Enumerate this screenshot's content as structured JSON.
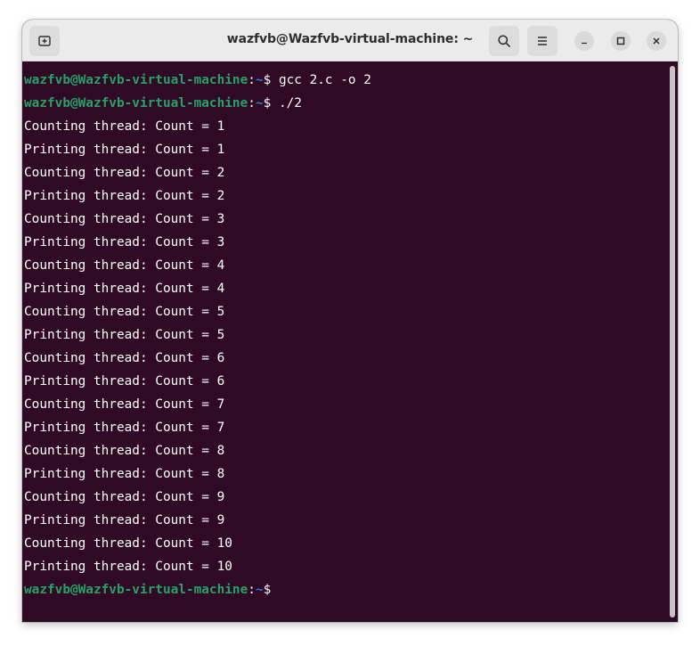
{
  "window": {
    "title": "wazfvb@Wazfvb-virtual-machine: ~"
  },
  "icons": {
    "new_tab": "new-tab-icon",
    "search": "search-icon",
    "menu": "hamburger-menu-icon",
    "minimize": "minimize-icon",
    "maximize": "maximize-icon",
    "close": "close-icon"
  },
  "colors": {
    "terminal_bg": "#300a24",
    "prompt_user": "#26a269",
    "prompt_path": "#2a7bde",
    "text": "#ffffff"
  },
  "terminal": {
    "prompt": {
      "user_host": "wazfvb@Wazfvb-virtual-machine",
      "separator": ":",
      "path": "~",
      "symbol": "$"
    },
    "commands": [
      " gcc 2.c -o 2",
      " ./2"
    ],
    "output": [
      "Counting thread: Count = 1",
      "Printing thread: Count = 1",
      "Counting thread: Count = 2",
      "Printing thread: Count = 2",
      "Counting thread: Count = 3",
      "Printing thread: Count = 3",
      "Counting thread: Count = 4",
      "Printing thread: Count = 4",
      "Counting thread: Count = 5",
      "Printing thread: Count = 5",
      "Counting thread: Count = 6",
      "Printing thread: Count = 6",
      "Counting thread: Count = 7",
      "Printing thread: Count = 7",
      "Counting thread: Count = 8",
      "Printing thread: Count = 8",
      "Counting thread: Count = 9",
      "Printing thread: Count = 9",
      "Counting thread: Count = 10",
      "Printing thread: Count = 10"
    ]
  }
}
